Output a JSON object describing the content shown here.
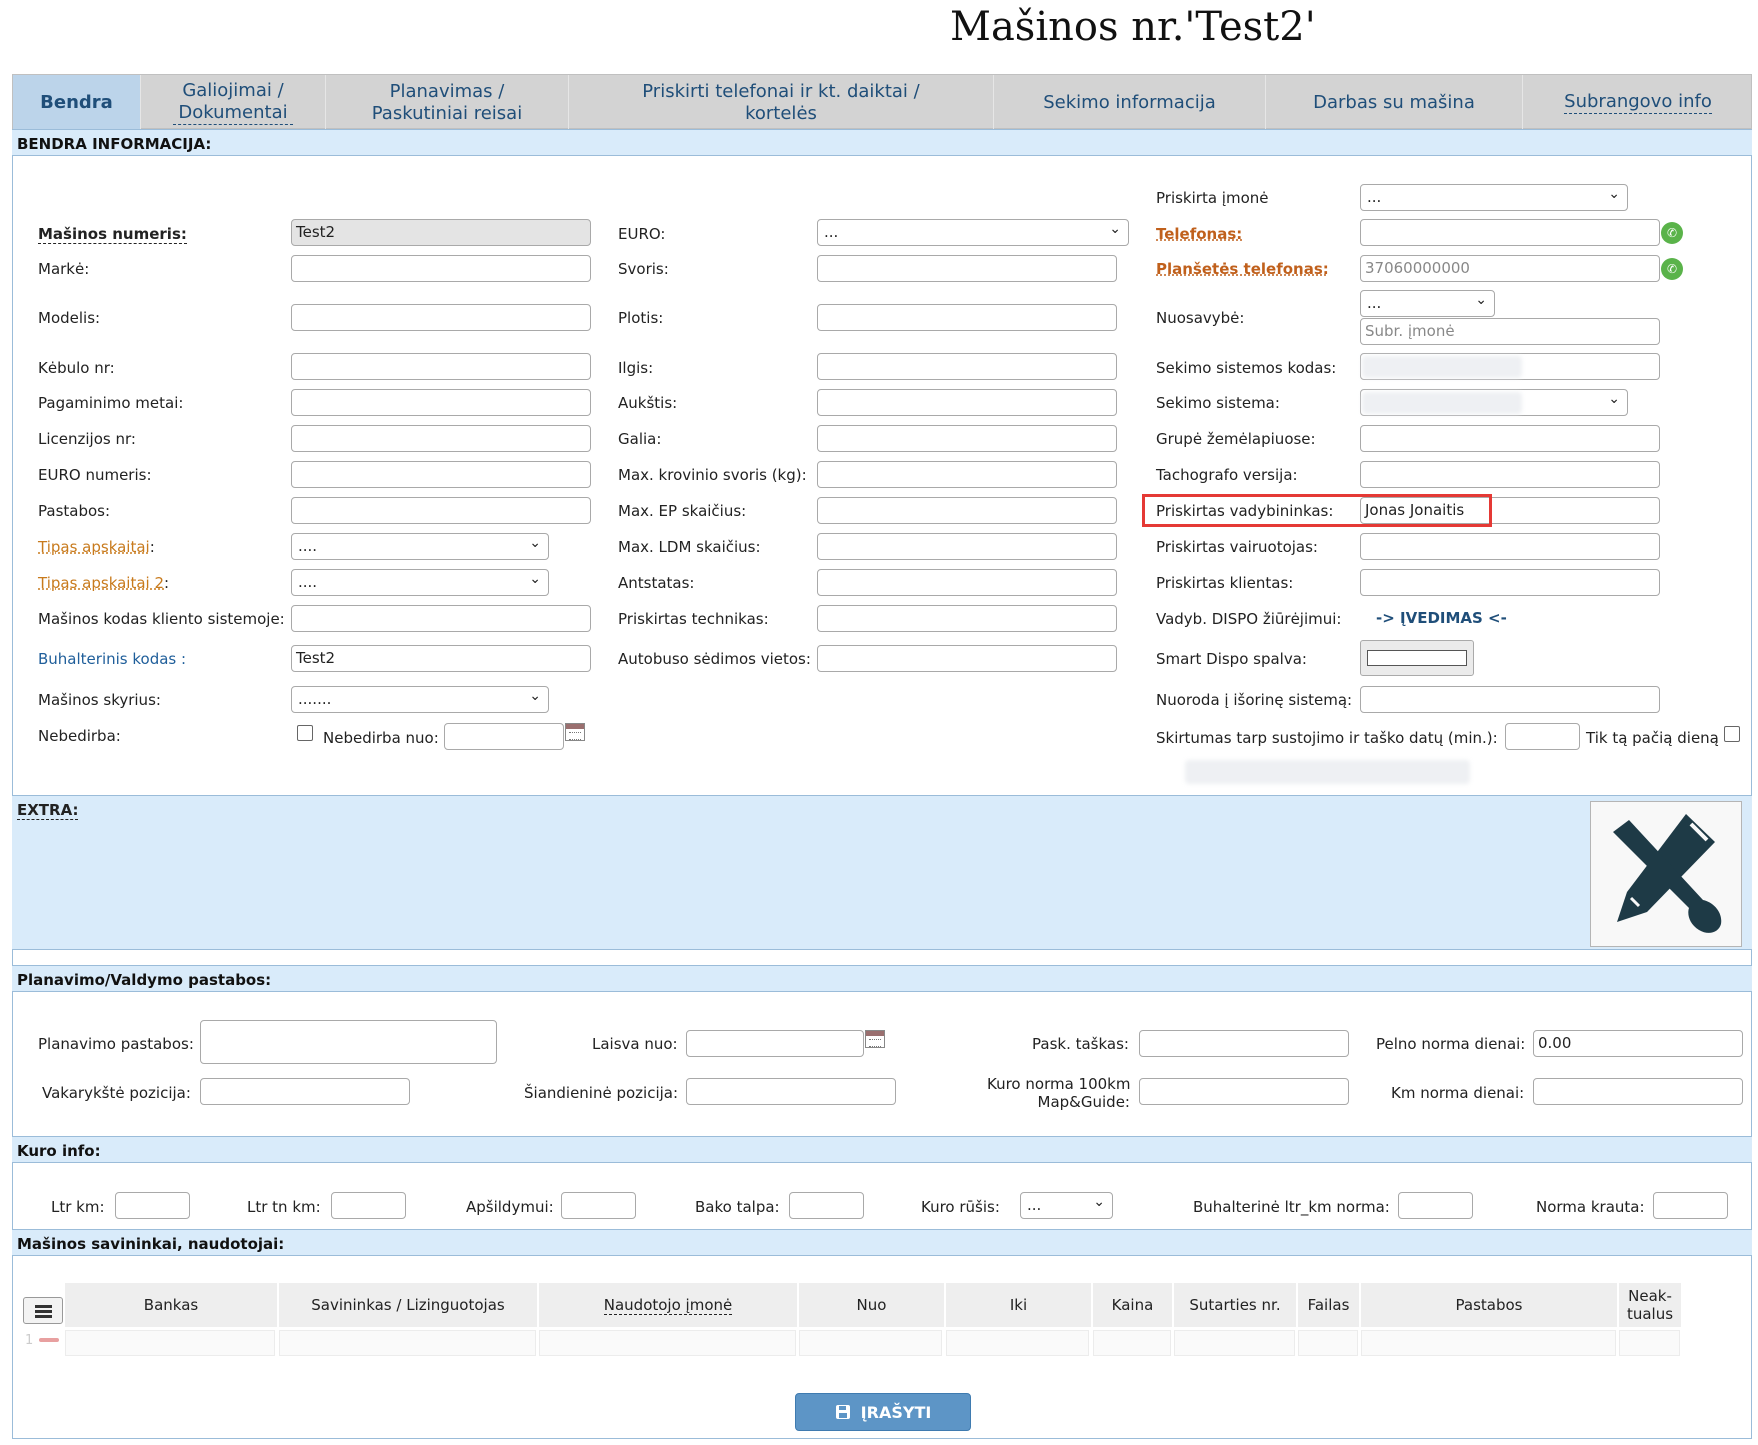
{
  "page_title": "Mašinos nr.'Test2'",
  "tabs": [
    {
      "label": "Bendra"
    },
    {
      "label": "Galiojimai / Dokumentai"
    },
    {
      "label": "Planavimas / Paskutiniai reisai"
    },
    {
      "label": "Priskirti telefonai ir kt. daiktai / kortelės"
    },
    {
      "label": "Sekimo informacija"
    },
    {
      "label": "Darbas su mašina"
    },
    {
      "label": "Subrangovo info"
    }
  ],
  "sections": {
    "general": "BENDRA INFORMACIJA:",
    "extra": "EXTRA:",
    "planning": "Planavimo/Valdymo pastabos:",
    "fuel": "Kuro info:",
    "owners": "Mašinos savininkai, naudotojai:"
  },
  "col1": {
    "vehicle_number_label": "Mašinos numeris:",
    "vehicle_number_value": "Test2",
    "brand_label": "Markė:",
    "model_label": "Modelis:",
    "body_label": "Kėbulo nr:",
    "year_label": "Pagaminimo metai:",
    "license_label": "Licenzijos nr:",
    "euro_number_label": "EURO numeris:",
    "notes_label": "Pastabos:",
    "accounting_type_label": "Tipas apskaitai",
    "accounting_type_value": "....",
    "accounting_type2_label": "Tipas apskaitai 2",
    "accounting_type2_value": "....",
    "colon": ":",
    "client_code_label": "Mašinos kodas kliento sistemoje:",
    "accounting_code_label": "Buhalterinis kodas :",
    "accounting_code_value": "Test2",
    "department_label": "Mašinos skyrius:",
    "department_value": ".......",
    "inactive_label": "Nebedirba:",
    "inactive_from_label": "Nebedirba nuo:"
  },
  "col2": {
    "euro_label": "EURO:",
    "euro_value": "...",
    "weight_label": "Svoris:",
    "width_label": "Plotis:",
    "length_label": "Ilgis:",
    "height_label": "Aukštis:",
    "power_label": "Galia:",
    "max_load_label": "Max. krovinio svoris (kg):",
    "max_ep_label": "Max. EP skaičius:",
    "max_ldm_label": "Max. LDM skaičius:",
    "trailer_label": "Antstatas:",
    "technician_label": "Priskirtas technikas:",
    "bus_seats_label": "Autobuso sėdimos vietos:"
  },
  "col3": {
    "company_label": "Priskirta įmonė",
    "company_value": "...",
    "phone_label": "Telefonas:",
    "tablet_phone_label": "Planšetės telefonas:",
    "tablet_phone_value": "37060000000",
    "ownership_label": "Nuosavybė:",
    "ownership_value": "...",
    "subcompany_placeholder": "Subr. įmonė",
    "tracking_code_label": "Sekimo sistemos kodas:",
    "tracking_system_label": "Sekimo sistema:",
    "map_group_label": "Grupė žemėlapiuose:",
    "tachograph_label": "Tachografo versija:",
    "manager_label": "Priskirtas vadybininkas:",
    "manager_value": "Jonas Jonaitis",
    "driver_label": "Priskirtas vairuotojas:",
    "client_label": "Priskirtas klientas:",
    "dispo_label": "Vadyb. DISPO žiūrėjimui:",
    "dispo_link": "-> ĮVEDIMAS <-",
    "color_label": "Smart Dispo spalva:",
    "external_link_label": "Nuoroda į išorinę sistemą:",
    "stop_diff_label": "Skirtumas tarp sustojimo ir taško datų (min.):",
    "same_day_label": "Tik tą pačią dieną"
  },
  "planning": {
    "notes_label": "Planavimo pastabos:",
    "free_from_label": "Laisva nuo:",
    "last_point_label": "Pask. taškas:",
    "profit_norm_label": "Pelno norma dienai:",
    "profit_norm_value": "0.00",
    "yesterday_pos_label": "Vakarykštė pozicija:",
    "today_pos_label": "Šiandieninė pozicija:",
    "fuel_norm_label_1": "Kuro norma 100km",
    "fuel_norm_label_2": "Map&Guide:",
    "km_norm_label": "Km norma dienai:"
  },
  "fuel": {
    "ltr_km_label": "Ltr km:",
    "ltr_tn_km_label": "Ltr tn km:",
    "heating_label": "Apšildymui:",
    "tank_label": "Bako talpa:",
    "fuel_type_label": "Kuro rūšis:",
    "fuel_type_value": "...",
    "acc_norm_label": "Buhalterinė ltr_km norma:",
    "loaded_norm_label": "Norma krauta:"
  },
  "owners_table": {
    "columns": [
      "Bankas",
      "Savininkas / Lizinguotojas",
      "Naudotojo įmonė",
      "Nuo",
      "Iki",
      "Kaina",
      "Sutarties nr.",
      "Failas",
      "Pastabos",
      "Neak-tualus"
    ],
    "row_index": "1"
  },
  "save_button": "ĮRAŠYTI",
  "colors": {
    "tab_bg": "#d3d3d3",
    "active_tab_bg": "#bcd4ea",
    "section_bg": "#d9ebfa",
    "link_blue": "#1f4e79",
    "orange_label": "#c87a1c",
    "highlight_red": "#e53935",
    "save_button_bg": "#5d95c6"
  }
}
